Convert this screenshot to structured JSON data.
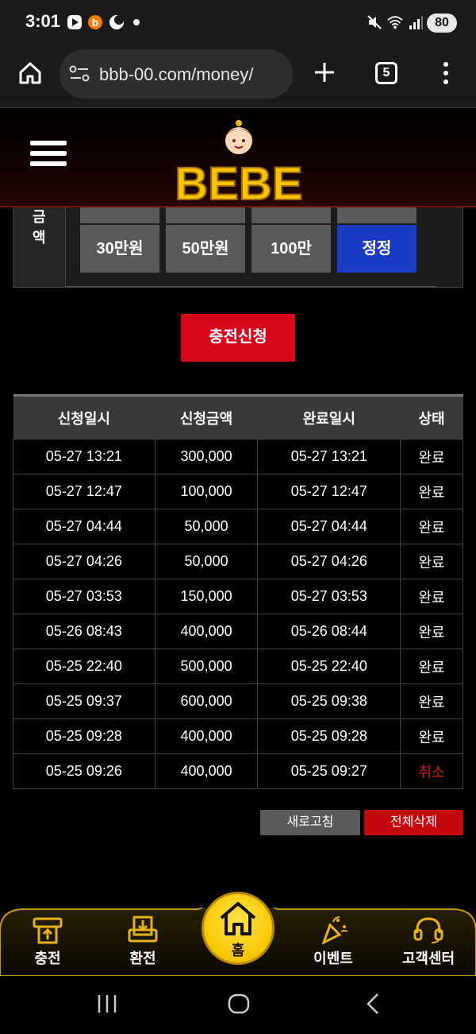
{
  "status_bar": {
    "time": "3:01",
    "battery": "80",
    "icons": [
      "play-icon",
      "b-app-icon",
      "moon-app-icon",
      "mute-icon",
      "wifi-icon",
      "signal-icon"
    ]
  },
  "browser": {
    "url": "bbb-00.com/money/",
    "tab_count": "5",
    "icons": [
      "home-icon",
      "site-settings-icon",
      "plus-icon",
      "tabs-icon",
      "more-icon"
    ]
  },
  "header": {
    "logo_text": "BEBE"
  },
  "amount_section": {
    "label_chars": [
      "금",
      "액"
    ],
    "buttons": [
      "30만원",
      "50만원",
      "100만",
      "정정"
    ]
  },
  "submit_label": "충전신청",
  "history": {
    "headers": [
      "신청일시",
      "신청금액",
      "완료일시",
      "상태"
    ],
    "rows": [
      [
        "05-27 13:21",
        "300,000",
        "05-27 13:21",
        "완료"
      ],
      [
        "05-27 12:47",
        "100,000",
        "05-27 12:47",
        "완료"
      ],
      [
        "05-27 04:44",
        "50,000",
        "05-27 04:44",
        "완료"
      ],
      [
        "05-27 04:26",
        "50,000",
        "05-27 04:26",
        "완료"
      ],
      [
        "05-27 03:53",
        "150,000",
        "05-27 03:53",
        "완료"
      ],
      [
        "05-26 08:43",
        "400,000",
        "05-26 08:44",
        "완료"
      ],
      [
        "05-25 22:40",
        "500,000",
        "05-25 22:40",
        "완료"
      ],
      [
        "05-25 09:37",
        "600,000",
        "05-25 09:38",
        "완료"
      ],
      [
        "05-25 09:28",
        "400,000",
        "05-25 09:28",
        "완료"
      ],
      [
        "05-25 09:26",
        "400,000",
        "05-25 09:27",
        "취소"
      ]
    ]
  },
  "actions": {
    "refresh": "새로고침",
    "delete_all": "전체삭제"
  },
  "bottom_nav": {
    "deposit": "충전",
    "withdraw": "환전",
    "home": "홈",
    "event": "이벤트",
    "support": "고객센터"
  },
  "colors": {
    "accent_red": "#d8061b",
    "accent_blue": "#1a3cc4",
    "nav_gold": "#f7c600",
    "cancel_red": "#e01818"
  }
}
